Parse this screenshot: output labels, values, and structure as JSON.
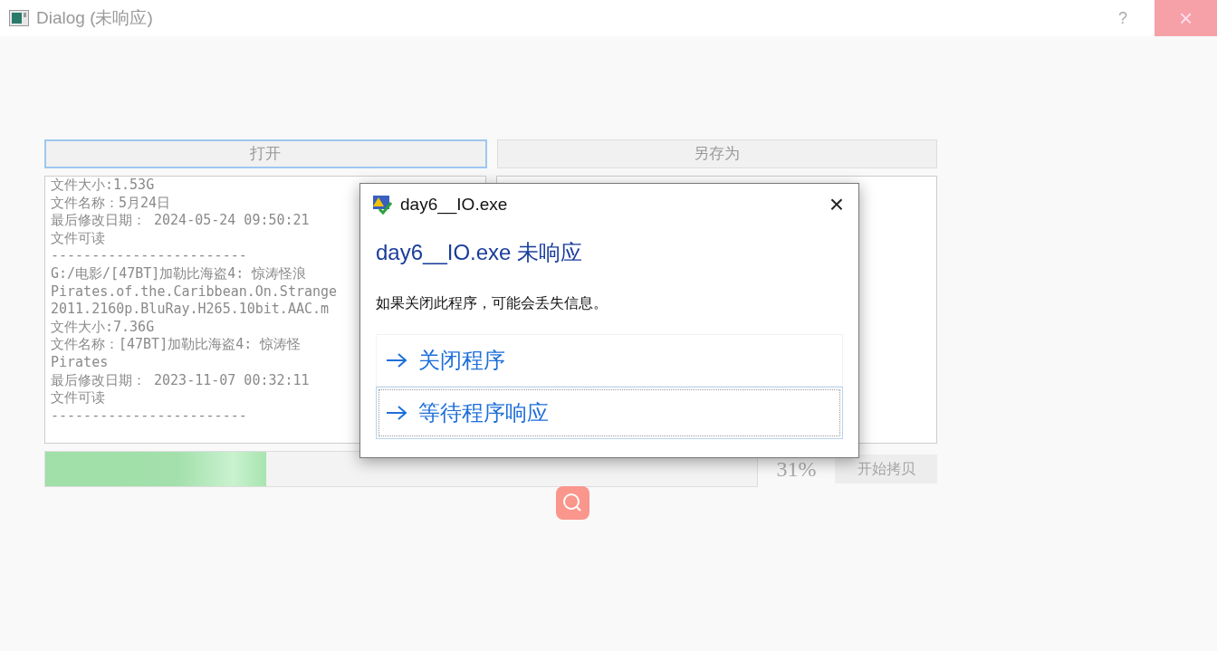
{
  "window": {
    "title": "Dialog (未响应)",
    "help": "?",
    "close": "×"
  },
  "buttons": [
    {
      "label": "打开",
      "focused": true
    },
    {
      "label": "另存为",
      "focused": false
    }
  ],
  "log": [
    "文件大小:1.53G",
    "文件名称：5月24日",
    "最后修改日期： 2024-05-24 09:50:21",
    "文件可读",
    "------------------------",
    "G:/电影/[47BT]加勒比海盗4: 惊涛怪浪",
    "Pirates.of.the.Caribbean.On.Strange",
    "2011.2160p.BluRay.H265.10bit.AAC.m",
    "文件大小:7.36G",
    "文件名称：[47BT]加勒比海盗4: 惊涛怪",
    "Pirates",
    "最后修改日期： 2023-11-07 00:32:11",
    "文件可读",
    "------------------------"
  ],
  "progress": {
    "level": 0.31,
    "reading": "31%"
  },
  "copy_button": {
    "label": "开始拷贝",
    "disabled": true
  },
  "dialog": {
    "title": "day6__IO.exe",
    "close": "×",
    "heading": "day6__IO.exe 未响应",
    "message": "如果关闭此程序，可能会丢失信息。",
    "options": [
      {
        "label": "关闭程序",
        "selected": false
      },
      {
        "label": "等待程序响应",
        "selected": true
      }
    ]
  }
}
